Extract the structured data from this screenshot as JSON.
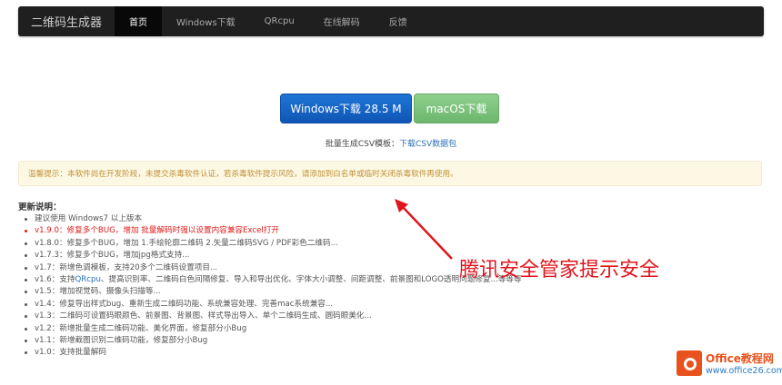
{
  "navbar": {
    "brand": "二维码生成器",
    "items": [
      {
        "label": "首页",
        "active": true
      },
      {
        "label": "Windows下载",
        "active": false
      },
      {
        "label": "QRcpu",
        "active": false
      },
      {
        "label": "在线解码",
        "active": false
      },
      {
        "label": "反馈",
        "active": false
      }
    ]
  },
  "downloads": {
    "windows_label": "Windows下载 28.5 M",
    "mac_label": "macOS下载"
  },
  "csv": {
    "prefix": "批量生成CSV模板：",
    "link": "下载CSV数据包"
  },
  "warning": "温馨提示：本软件尚在开发阶段，未提交杀毒软件认证，若杀毒软件提示风险，请添加到白名单或临时关闭杀毒软件再使用。",
  "updates": {
    "title": "更新说明：",
    "items": [
      "建议使用 Windows7 以上版本",
      "v1.9.0：修复多个BUG，增加 批量解码时强以设置内容兼容Excel打开",
      "v1.8.0：修复多个BUG，增加 1.手绘轮廓二维码 2.矢量二维码SVG / PDF彩色二维码...",
      "v1.7.3：修复多个BUG，增加jpg格式支持...",
      "v1.7：新增色调模板，支持20多个二维码设置项目...",
      "v1.6：支持",
      "QRcpu",
      "、提高识别率、二维码白色间隔修复、导入和导出优化、字体大小调整、间距调整、前景图和LOGO透明问题修复...等等等",
      "v1.5：增加视觉码、摄像头扫描等...",
      "v1.4：修复导出样式bug、重新生成二维码功能、系统兼容处理、完善mac系统兼容...",
      "v1.3：二维码可设置码眼颜色、前景图、背景图、样式导出导入、单个二维码生成、圆码眼美化...",
      "v1.2：新增批量生成二维码功能、美化界面，修复部分小Bug",
      "v1.1：新增截图识别二维码功能，修复部分小Bug",
      "v1.0：支持批量解码"
    ]
  },
  "annotation": "腾讯安全管家提示安全",
  "watermark": {
    "title": "Office教程网",
    "url": "www.office26.com"
  },
  "colors": {
    "navbar_bg": "#1f1f1f",
    "windows_button": "#1565c8",
    "mac_button": "#7dc47d",
    "warning_text": "#c0903a",
    "annotation_red": "#e0151d"
  },
  "icons": [
    "office-logo-icon",
    "arrow-icon"
  ]
}
